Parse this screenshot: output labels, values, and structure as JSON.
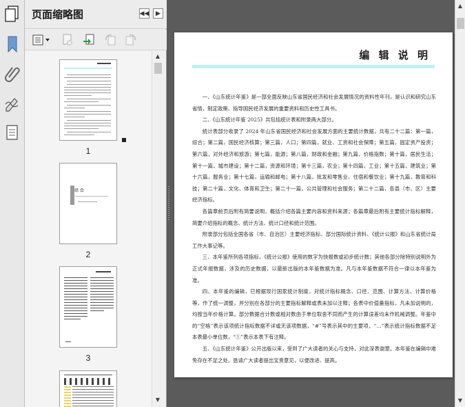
{
  "panel": {
    "title": "页面缩略图"
  },
  "thumbnails": [
    {
      "label": "1"
    },
    {
      "label": "2",
      "chapter_title": "综 合"
    },
    {
      "label": "3"
    },
    {
      "label": ""
    }
  ],
  "document": {
    "heading": "编 辑 说 明",
    "paragraphs": [
      "一、《山东统计年鉴》是一部全面反映山东省国民经济和社会发展情况的资料性年刊，是认识和研究山东省情，制定政策、指导国民经济发展的重要资料和历史性工具书。",
      "二、《山东统计年鉴 2025》共包括统计表和附录两大部分。",
      "统计表部分收录了 2024 年山东省国民经济和社会发展方面的主要统计数据，共有二十二篇：第一篇，综合；第二篇，国民经济核算；第三篇，人口；第四篇，就业、工资和社会保障；第五篇，固定资产投资；第六篇，对外经济和旅游；第七篇，能源；第八篇，财政和金融；第九篇，价格指数；第十篇，居民生活；第十一篇，城市建设；第十二篇，资源和环境；第十三篇，农业；第十四篇，工业；第十五篇，建筑业；第十六篇，服务业；第十七篇，运输和邮电；第十八篇，批发和零售业、住宿和餐饮业；第十九篇，教育和科技；第二十篇，文化、体育和卫生；第二十一篇，公共管理和社会服务；第二十二篇，各县（市、区）主要经济指标。",
      "各篇章前页后附有简要说明，概括介绍各篇主要内容和资料来源；各篇章最后附有主要统计指标解释，简要介绍指标的概念、统计方法、统计口径和统计范围。",
      "附录部分包括全国各省（市、自治区）主要经济指标、部分国际统计资料、《统计公报》和山东省统计局工作大事记等。",
      "三、本年鉴所列各项指标，《统计公报》使用的数字为快报数或初步统计数；其他各部分除特别说明外为正式年报数据，涉及的历史数据，以最新出版的本年鉴数据为准。凡与本年鉴数据不符合一律以本年鉴为准。",
      "四、本年鉴的编辑，已根据现行国家统计制度，对统计指标概念、口径、范围、计算方法、计算价格等，作了统一调整，并分别在各部分的主要指标解释或表未加以注释；各表中价值量指标，凡未加说明的，均按当年价格计算。部分数据合计数或相对数由于单位取舍不同而产生的计算误差均未作机械调整。年鉴中的“空格”表示该项统计指标数据不详或无该项数据，“#”号表示其中的主要项，“…”表示统计指标数据不足本表最小单位数，“①”表示本表下有注释。",
      "五、《山东统计年鉴》公开出版以来，受到了广大读者的关心与支持，对此深表谢意。本年鉴在编辑中难免存在不足之处，恳请广大读者提出宝贵意见，以便改进、提高。"
    ]
  },
  "icons": {
    "strip": [
      "pages-panel-icon",
      "bookmark-icon",
      "attachment-icon",
      "signature-icon",
      "layers-icon"
    ],
    "toolbar": [
      "thumbnail-options-icon",
      "delete-page-icon",
      "insert-page-icon",
      "rotate-ccw-icon",
      "rotate-cw-icon"
    ]
  },
  "colors": {
    "accent_bar": "#bff0f4",
    "bookmark": "#6b9bd1",
    "insert_green": "#2e9a3a"
  }
}
